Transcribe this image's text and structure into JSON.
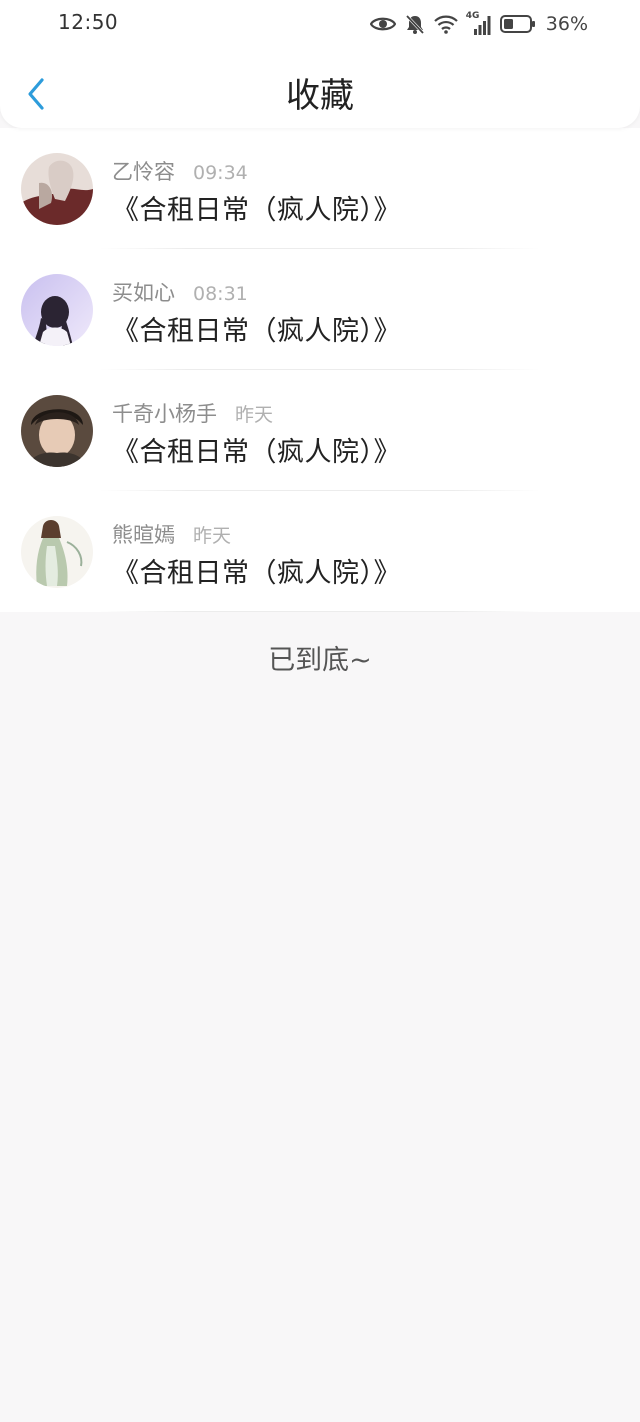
{
  "status_bar": {
    "time": "12:50",
    "network": "4G",
    "battery": "36%"
  },
  "header": {
    "title": "收藏",
    "back_icon": "chevron-left-icon"
  },
  "items": [
    {
      "name": "乙怜容",
      "time": "09:34",
      "title": "《合租日常（疯人院）》"
    },
    {
      "name": "买如心",
      "time": "08:31",
      "title": "《合租日常（疯人院）》"
    },
    {
      "name": "千奇小杨手",
      "time": "昨天",
      "title": "《合租日常（疯人院）》"
    },
    {
      "name": "熊暄嫣",
      "time": "昨天",
      "title": "《合租日常（疯人院）》"
    }
  ],
  "footer_note": "已到底~",
  "colors": {
    "accent": "#2d9cdb",
    "background": "#f8f7f8",
    "card": "#ffffff"
  }
}
